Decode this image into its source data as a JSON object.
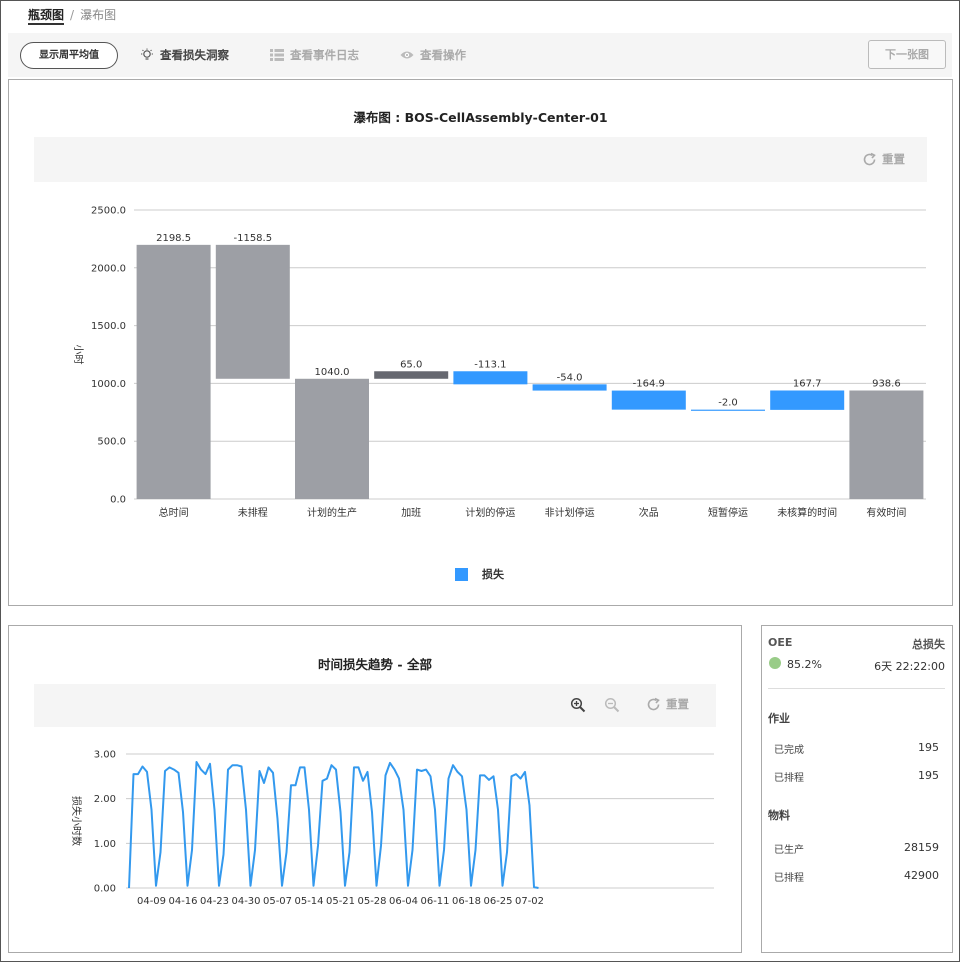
{
  "breadcrumb": {
    "current": "瓶颈图",
    "separator": "/",
    "next": "瀑布图"
  },
  "toolbar": {
    "show_avg": "显示周平均值",
    "loss_insight": "查看损失洞察",
    "event_log": "查看事件日志",
    "view_ops": "查看操作",
    "next_chart": "下一张图"
  },
  "icons": {
    "insight": "lightbulb-icon",
    "log": "list-icon",
    "ops": "eye-icon",
    "reset": "refresh-icon",
    "zoom_in": "zoom-in-icon",
    "zoom_out": "zoom-out-icon"
  },
  "waterfall": {
    "title": "瀑布图 : BOS-CellAssembly-Center-01",
    "reset": "重置",
    "legend": "损失"
  },
  "trend": {
    "title": "时间损失趋势 - 全部",
    "reset": "重置"
  },
  "summary": {
    "oee_label": "OEE",
    "total_loss_label": "总损失",
    "oee_value": "85.2%",
    "total_loss_value": "6天 22:22:00",
    "oee_color": "#99cc88",
    "ops_label": "作业",
    "ops": [
      {
        "label": "已完成",
        "value": "195"
      },
      {
        "label": "已排程",
        "value": "195"
      }
    ],
    "material_label": "物料",
    "material": [
      {
        "label": "已生产",
        "value": "28159"
      },
      {
        "label": "已排程",
        "value": "42900"
      }
    ]
  },
  "chart_data": [
    {
      "type": "bar",
      "subtype": "waterfall",
      "title": "瀑布图 : BOS-CellAssembly-Center-01",
      "ylabel": "小时",
      "ylim": [
        0,
        2500
      ],
      "yticks": [
        "0.0",
        "500.0",
        "1000.0",
        "1500.0",
        "2000.0",
        "2500.0"
      ],
      "categories": [
        "总时间",
        "未排程",
        "计划的生产",
        "加班",
        "计划的停运",
        "非计划停运",
        "次品",
        "短暂停运",
        "未核算的时间",
        "有效时间"
      ],
      "labels": [
        "2198.5",
        "-1158.5",
        "1040.0",
        "65.0",
        "-113.1",
        "-54.0",
        "-164.9",
        "-2.0",
        "167.7",
        "938.6"
      ],
      "bars": [
        {
          "low": 0,
          "high": 2198.5,
          "kind": "total"
        },
        {
          "low": 1040.0,
          "high": 2198.5,
          "kind": "total"
        },
        {
          "low": 0,
          "high": 1040.0,
          "kind": "total"
        },
        {
          "low": 1040.0,
          "high": 1105.0,
          "kind": "gain"
        },
        {
          "low": 991.9,
          "high": 1105.0,
          "kind": "loss"
        },
        {
          "low": 937.9,
          "high": 991.9,
          "kind": "loss"
        },
        {
          "low": 773.0,
          "high": 937.9,
          "kind": "loss"
        },
        {
          "low": 771.0,
          "high": 773.0,
          "kind": "loss"
        },
        {
          "low": 771.0,
          "high": 938.7,
          "kind": "loss"
        },
        {
          "low": 0,
          "high": 938.6,
          "kind": "total"
        }
      ],
      "colors": {
        "total": "#9d9fa5",
        "gain": "#666870",
        "loss": "#3399ff"
      },
      "legend": [
        "损失"
      ],
      "legend_position": "bottom",
      "grid": true
    },
    {
      "type": "line",
      "title": "时间损失趋势 - 全部",
      "ylabel": "损失小时数",
      "ylim": [
        0,
        3
      ],
      "yticks": [
        "0.00",
        "1.00",
        "2.00",
        "3.00"
      ],
      "xticks": [
        "04-09",
        "04-16",
        "04-23",
        "04-30",
        "05-07",
        "05-14",
        "05-21",
        "05-28",
        "06-04",
        "06-11",
        "06-18",
        "06-25",
        "07-02"
      ],
      "x_start": "04-04",
      "values": [
        0.0,
        2.55,
        2.55,
        2.72,
        2.6,
        1.75,
        0.05,
        0.8,
        2.62,
        2.7,
        2.65,
        2.58,
        1.7,
        0.05,
        0.85,
        2.82,
        2.65,
        2.55,
        2.78,
        1.75,
        0.05,
        0.75,
        2.65,
        2.75,
        2.75,
        2.72,
        1.75,
        0.05,
        0.85,
        2.62,
        2.35,
        2.7,
        2.58,
        1.55,
        0.05,
        0.8,
        2.3,
        2.3,
        2.7,
        2.7,
        1.75,
        0.05,
        0.95,
        2.4,
        2.45,
        2.75,
        2.65,
        1.7,
        0.05,
        0.8,
        2.7,
        2.7,
        2.4,
        2.6,
        1.7,
        0.05,
        0.95,
        2.52,
        2.8,
        2.65,
        2.45,
        1.75,
        0.05,
        0.85,
        2.65,
        2.62,
        2.65,
        2.5,
        1.75,
        0.05,
        0.85,
        2.45,
        2.75,
        2.6,
        2.5,
        1.75,
        0.05,
        0.85,
        2.52,
        2.52,
        2.42,
        2.5,
        1.75,
        0.05,
        0.8,
        2.5,
        2.55,
        2.45,
        2.6,
        1.85,
        0.02,
        0.0
      ],
      "color": "#3399ee",
      "grid": true
    }
  ]
}
